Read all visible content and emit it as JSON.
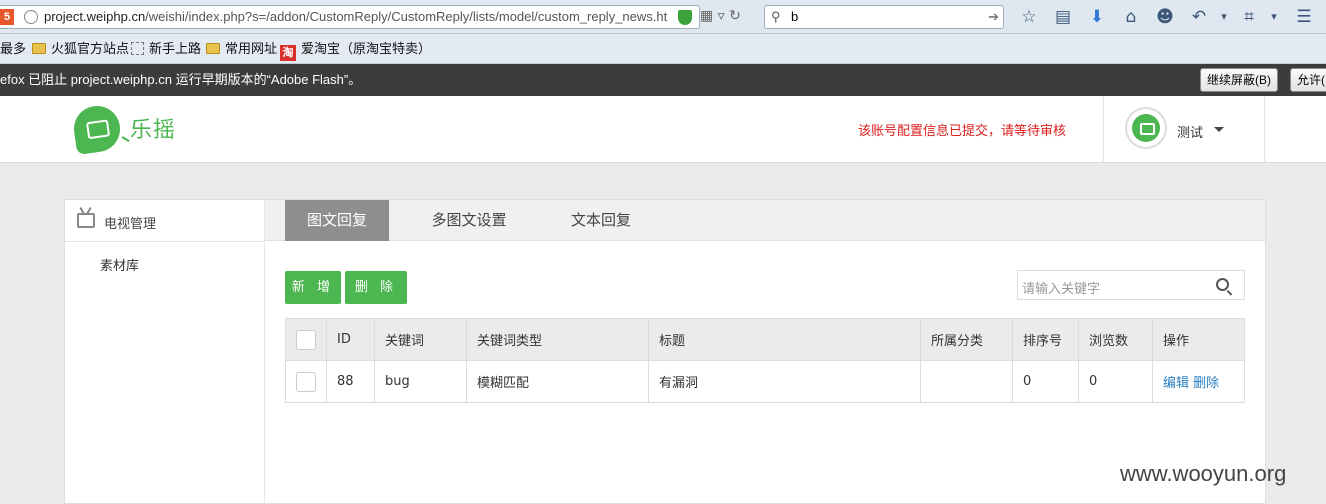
{
  "browser": {
    "url_host": "project.weiphp.cn",
    "url_path": "/weishi/index.php?s=/addon/CustomReply/CustomReply/lists/model/custom_reply_news.ht",
    "search_value": "b",
    "bookmarks": [
      "最多",
      "火狐官方站点",
      "新手上路",
      "常用网址",
      "爱淘宝（原淘宝特卖）"
    ],
    "notification": "efox 已阻止 project.weiphp.cn 运行早期版本的“Adobe Flash”。",
    "continue_block_label": "继续屏蔽(B)",
    "allow_label": "允许(",
    "taobao_glyph": "淘"
  },
  "header": {
    "logo_text": "乐摇",
    "notice": "该账号配置信息已提交，请等待审核",
    "username": "测试"
  },
  "sidebar": {
    "section_label": "电视管理",
    "items": [
      "素材库"
    ]
  },
  "tabs": [
    "图文回复",
    "多图文设置",
    "文本回复"
  ],
  "actions": {
    "add_label": "新 增",
    "delete_label": "删 除"
  },
  "search": {
    "placeholder": "请输入关键字"
  },
  "table": {
    "columns": [
      "ID",
      "关键词",
      "关键词类型",
      "标题",
      "所属分类",
      "排序号",
      "浏览数",
      "操作"
    ],
    "rows": [
      {
        "id": "88",
        "keyword": "bug",
        "keyword_type": "模糊匹配",
        "title": "有漏洞",
        "category": "",
        "sort": "0",
        "views": "0",
        "edit": "编辑",
        "delete": "删除"
      }
    ]
  },
  "watermark": "www.wooyun.org",
  "colors": {
    "brand_green": "#4cb650",
    "notice_red": "#d9201f",
    "link_blue": "#2a7fc0",
    "active_tab": "#8e8e8e"
  }
}
